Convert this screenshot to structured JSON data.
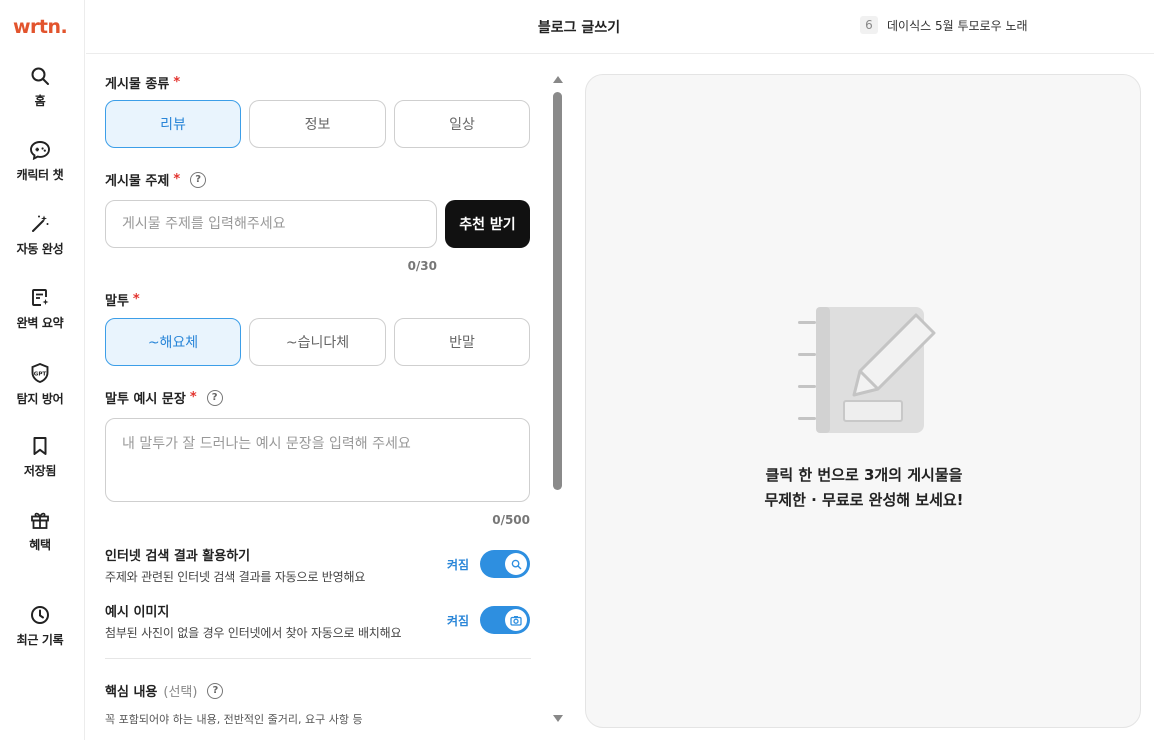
{
  "app": {
    "logo": "wrtn."
  },
  "sidebar": {
    "items": [
      {
        "label": "홈",
        "icon": "search-icon"
      },
      {
        "label": "캐릭터 챗",
        "icon": "gamepad-chat-icon"
      },
      {
        "label": "자동 완성",
        "icon": "magic-wand-icon"
      },
      {
        "label": "완벽 요약",
        "icon": "document-sparkle-icon"
      },
      {
        "label": "탐지 방어",
        "icon": "gpt-shield-icon"
      },
      {
        "label": "저장됨",
        "icon": "bookmark-icon"
      },
      {
        "label": "혜택",
        "icon": "gift-icon"
      },
      {
        "label": "최근 기록",
        "icon": "clock-icon"
      }
    ]
  },
  "header": {
    "title": "블로그 글쓰기",
    "trend_rank": "6",
    "trend_text": "데이식스 5월 투모로우 노래"
  },
  "form": {
    "post_type": {
      "label": "게시물 종류",
      "required": "*",
      "options": [
        "리뷰",
        "정보",
        "일상"
      ],
      "selected": "리뷰"
    },
    "topic": {
      "label": "게시물 주제",
      "required": "*",
      "help": "?",
      "value": "",
      "placeholder": "게시물 주제를 입력해주세요",
      "recommend_button": "추천 받기",
      "counter": "0/30"
    },
    "tone": {
      "label": "말투",
      "required": "*",
      "options": [
        "~해요체",
        "~습니다체",
        "반말"
      ],
      "selected": "~해요체"
    },
    "tone_example": {
      "label": "말투 예시 문장",
      "required": "*",
      "help": "?",
      "value": "",
      "placeholder": "내 말투가 잘 드러나는 예시 문장을 입력해 주세요",
      "counter": "0/500"
    },
    "internet_search": {
      "title": "인터넷 검색 결과 활용하기",
      "desc": "주제와 관련된 인터넷 검색 결과를 자동으로 반영해요",
      "state_label": "켜짐",
      "enabled": true,
      "icon": "search-icon"
    },
    "example_image": {
      "title": "예시 이미지",
      "desc": "첨부된 사진이 없을 경우 인터넷에서 찾아 자동으로 배치해요",
      "state_label": "켜짐",
      "enabled": true,
      "icon": "camera-icon"
    },
    "key_content": {
      "label": "핵심 내용",
      "optional": "(선택)",
      "help": "?",
      "desc": "꼭 포함되어야 하는 내용, 전반적인 줄거리, 요구 사항 등"
    }
  },
  "preview": {
    "line1": "클릭 한 번으로 3개의 게시물을",
    "line2": "무제한 · 무료로 완성해 보세요!",
    "illustration": "notebook-pencil-icon"
  },
  "colors": {
    "brand": "#e2542d",
    "accent": "#2e8fe0",
    "selected_bg": "#e9f4fd",
    "required": "#e3342f",
    "dark_button": "#111111"
  }
}
